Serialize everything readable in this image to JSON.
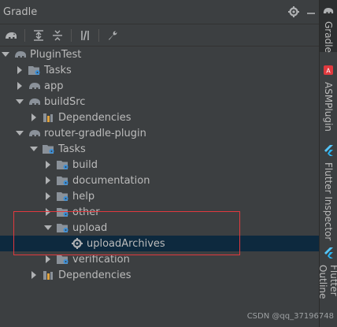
{
  "panel": {
    "title": "Gradle"
  },
  "toolbar": {
    "buttons": [
      "gradle-elephant-icon",
      "expand-all-icon",
      "collapse-all-icon",
      "toggle-offline-icon",
      "wrench-icon"
    ]
  },
  "tree": {
    "plugin_test": "PluginTest",
    "plugin_test_tasks": "Tasks",
    "app": "app",
    "buildsrc": "buildSrc",
    "buildsrc_dependencies": "Dependencies",
    "router_plugin": "router-gradle-plugin",
    "router_tasks": "Tasks",
    "task_groups": {
      "build": "build",
      "documentation": "documentation",
      "help": "help",
      "other": "other",
      "upload": "upload",
      "upload_archives": "uploadArchives",
      "verification": "verification"
    },
    "router_dependencies": "Dependencies"
  },
  "sidebar": {
    "tabs": [
      "Gradle",
      "ASMPlugin",
      "Flutter Inspector",
      "Flutter Outline"
    ]
  },
  "watermark": "CSDN @qq_37196748",
  "colors": {
    "background": "#3c3f41",
    "selection": "#0d293e",
    "highlight_box": "#e0393e",
    "folder": "#8a9199",
    "gear": "#3d8fd6"
  }
}
